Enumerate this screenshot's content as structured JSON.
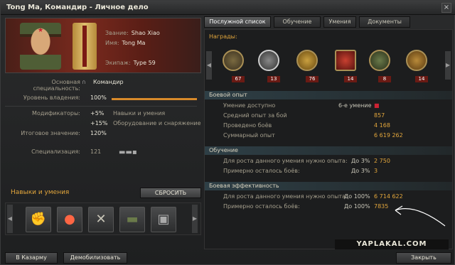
{
  "window": {
    "title": "Tong Ma, Командир - Личное дело",
    "close_glyph": "×"
  },
  "crew": {
    "rank_label": "Звание:",
    "rank_value": "Shao Xiao",
    "name_label": "Имя:",
    "name_value": "Tong Ma",
    "crew_label": "Экипаж:",
    "crew_value": "Type 59"
  },
  "stats": {
    "specialty_label": "Основная специальность:",
    "specialty_value": "Командир",
    "mastery_label": "Уровень владения:",
    "mastery_value": "100%",
    "mastery_level": 1.0,
    "modifiers_label": "Модификаторы:",
    "mod1_value": "+5%",
    "mod1_desc": "Навыки и умения",
    "mod2_value": "+15%",
    "mod2_desc": "Оборудование и снаряжение",
    "total_label": "Итоговое значение:",
    "total_value": "120%",
    "spec_label": "Специализация:",
    "spec_value": "121"
  },
  "skills": {
    "title": "Навыки и умения",
    "reset_label": "СБРОСИТЬ",
    "icons": [
      "fist-icon",
      "lightbulb-icon",
      "tools-icon",
      "tank-camo-icon",
      "radio-icon"
    ]
  },
  "bottom": {
    "barracks_label": "В Казарму",
    "demobilize_label": "Демобилизовать",
    "close_label": "Закрыть"
  },
  "tabs": [
    "Послужной список",
    "Обучение",
    "Умения",
    "Документы"
  ],
  "awards": {
    "title": "Награды:",
    "medals": [
      {
        "count": "67"
      },
      {
        "count": "13"
      },
      {
        "count": "76"
      },
      {
        "count": "14"
      },
      {
        "count": "8"
      },
      {
        "count": "14"
      }
    ]
  },
  "combat": {
    "title": "Боевой опыт",
    "rows": [
      {
        "label": "Умение доступно",
        "mid": "6-е умение",
        "value": ""
      },
      {
        "label": "Средний опыт за бой",
        "mid": "",
        "value": "857"
      },
      {
        "label": "Проведено боёв",
        "mid": "",
        "value": "4 168"
      },
      {
        "label": "Суммарный опыт",
        "mid": "",
        "value": "6 619 262"
      }
    ]
  },
  "training": {
    "title": "Обучение",
    "rows": [
      {
        "label": "Для роста данного умения нужно опыта:",
        "mid": "До 3%",
        "value": "2 750"
      },
      {
        "label": "Примерно осталось боёв:",
        "mid": "До 3%",
        "value": "3"
      }
    ]
  },
  "efficiency": {
    "title": "Боевая эффективность",
    "rows": [
      {
        "label": "Для роста данного умения нужно опыта:",
        "mid": "До 100%",
        "value": "6 714 622"
      },
      {
        "label": "Примерно осталось боёв:",
        "mid": "До 100%",
        "value": "7835"
      }
    ]
  },
  "watermark": "YAPLAKAL.COM"
}
